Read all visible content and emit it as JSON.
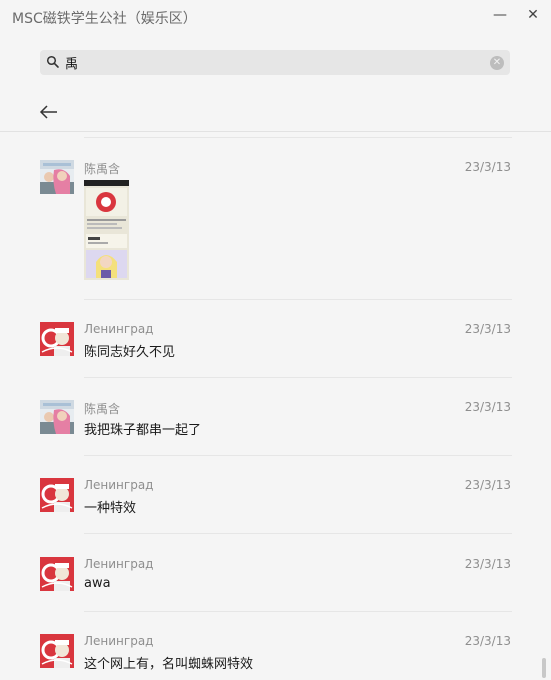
{
  "window": {
    "title": "MSC磁铁学生公社（娱乐区）",
    "minimize_glyph": "—",
    "close_glyph": "✕"
  },
  "search": {
    "value": "禹",
    "placeholder": ""
  },
  "messages": [
    {
      "sender": "陈禹含",
      "time": "23/3/13",
      "text": "",
      "avatar": "anime-girl-avatar",
      "attachment": "image-thumbnail"
    },
    {
      "sender": "Ленинград",
      "time": "23/3/13",
      "text": "陈同志好久不见",
      "avatar": "red-emblem-avatar"
    },
    {
      "sender": "陈禹含",
      "time": "23/3/13",
      "text": "我把珠子都串一起了",
      "avatar": "anime-girl-avatar"
    },
    {
      "sender": "Ленинград",
      "time": "23/3/13",
      "text": "一种特效",
      "avatar": "red-emblem-avatar"
    },
    {
      "sender": "Ленинград",
      "time": "23/3/13",
      "text": "awa",
      "avatar": "red-emblem-avatar"
    },
    {
      "sender": "Ленинград",
      "time": "23/3/13",
      "text": "这个网上有，名叫蜘蛛网特效",
      "avatar": "red-emblem-avatar"
    }
  ],
  "colors": {
    "background": "#f5f5f5",
    "search_bg": "#e6e6e6",
    "meta_text": "#8e8e8e",
    "avatar_red": "#d9363e"
  }
}
